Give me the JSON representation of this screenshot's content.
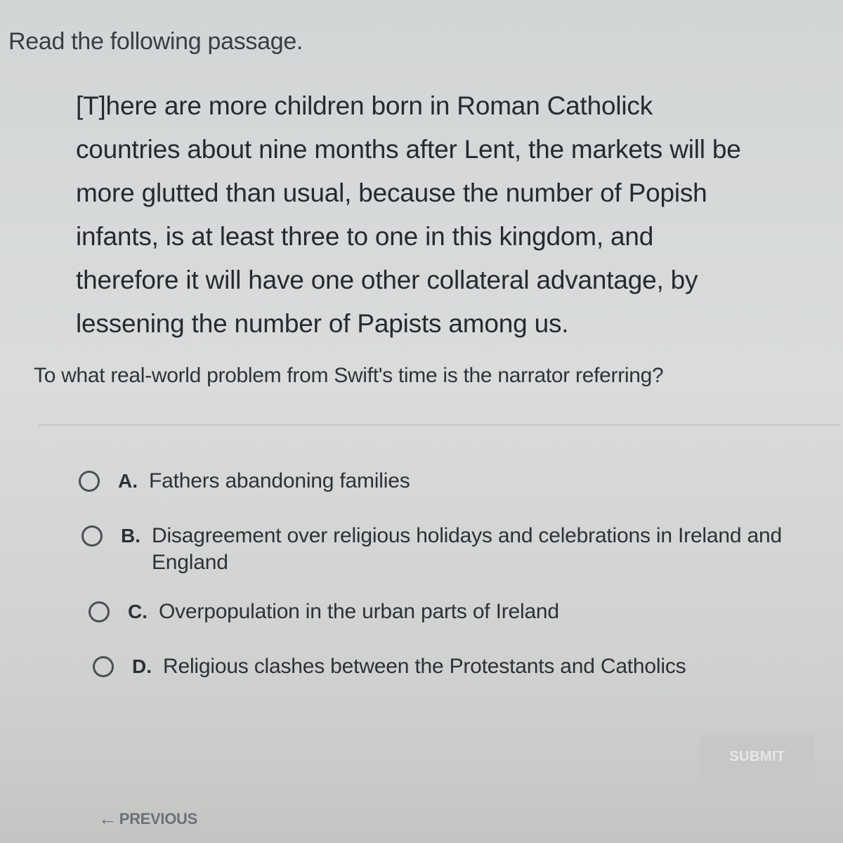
{
  "instruction": "Read the following passage.",
  "passage": {
    "lines": [
      "[T]here are more children born in Roman Catholick",
      "countries about nine months after Lent, the markets will be",
      "more glutted than usual, because the number of Popish",
      "infants, is at least three to one in this kingdom, and",
      "therefore it will have one other collateral advantage, by",
      "lessening the number of Papists among us."
    ]
  },
  "question": "To what real-world problem from Swift's time is the narrator referring?",
  "choices": [
    {
      "letter": "A.",
      "text": "Fathers abandoning families"
    },
    {
      "letter": "B.",
      "text": "Disagreement over religious holidays and celebrations in Ireland and England"
    },
    {
      "letter": "C.",
      "text": "Overpopulation in the urban parts of Ireland"
    },
    {
      "letter": "D.",
      "text": "Religious clashes between the Protestants and Catholics"
    }
  ],
  "footer": {
    "submit_label": "SUBMIT",
    "previous_label": "PREVIOUS",
    "previous_icon": "arrow-left-icon"
  }
}
